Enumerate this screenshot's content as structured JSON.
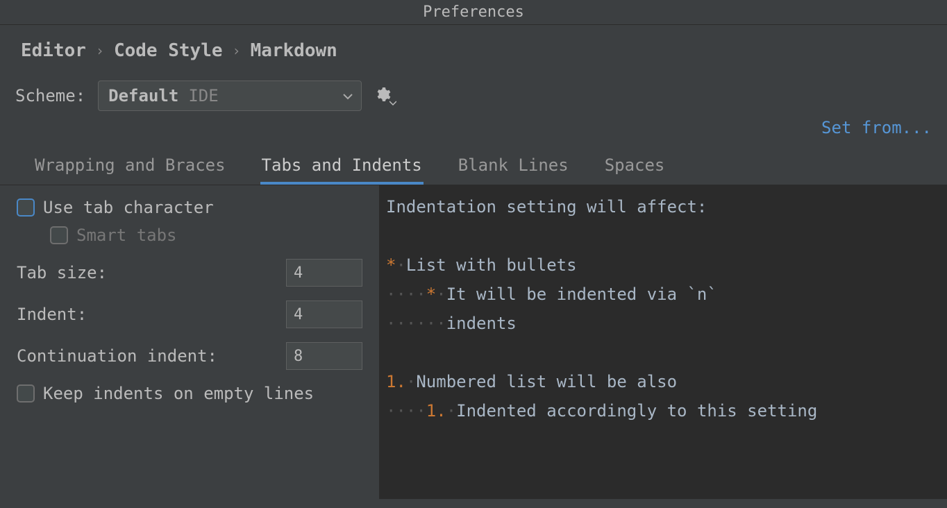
{
  "window": {
    "title": "Preferences"
  },
  "breadcrumb": {
    "item1": "Editor",
    "item2": "Code Style",
    "item3": "Markdown"
  },
  "scheme": {
    "label": "Scheme:",
    "name": "Default",
    "tag": "IDE"
  },
  "link": {
    "set_from": "Set from..."
  },
  "tabs": {
    "wrapping": "Wrapping and Braces",
    "tabs_indents": "Tabs and Indents",
    "blank_lines": "Blank Lines",
    "spaces": "Spaces"
  },
  "settings": {
    "use_tab_char": "Use tab character",
    "smart_tabs": "Smart tabs",
    "tab_size_label": "Tab size:",
    "tab_size_value": "4",
    "indent_label": "Indent:",
    "indent_value": "4",
    "cont_indent_label": "Continuation indent:",
    "cont_indent_value": "8",
    "keep_indents": "Keep indents on empty lines"
  },
  "preview": {
    "l1_text": "Indentation setting will affect:",
    "l3_bullet": "*",
    "l3_text": "List with bullets",
    "l4_bullet": "*",
    "l4_text": "It will be indented via `n`",
    "l5_text": "indents",
    "l7_num": "1.",
    "l7_text": "Numbered list will be also",
    "l8_num": "1.",
    "l8_text": "Indented accordingly to this setting"
  }
}
